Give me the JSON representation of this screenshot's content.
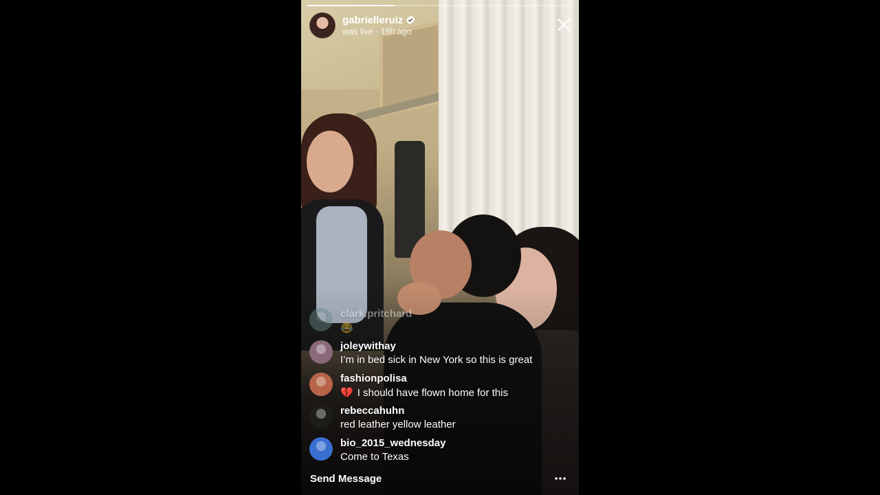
{
  "progress": 0.33,
  "host": {
    "username": "gabrielleruiz",
    "status": "was live · 16h ago",
    "verified": true
  },
  "comments": [
    {
      "username": "clark.pritchard",
      "text": "😂",
      "avatar_color": "#6a8b8e",
      "faded": true
    },
    {
      "username": "joleywithay",
      "text": "I’m in bed sick in New York so this is great",
      "avatar_color": "#8a6a7a"
    },
    {
      "username": "fashionpolisa",
      "emoji": "💔",
      "text": "I should have flown home for this",
      "avatar_color": "#b86448"
    },
    {
      "username": "rebeccahuhn",
      "text": "red leather yellow leather",
      "avatar_color": "#1c1e17"
    },
    {
      "username": "bio_2015_wednesday",
      "text": "Come to Texas",
      "avatar_color": "#3a6fd0"
    }
  ],
  "footer": {
    "send_label": "Send Message"
  },
  "icons": {
    "close": "close-icon",
    "more": "more-icon",
    "verified": "verified-badge-icon"
  }
}
